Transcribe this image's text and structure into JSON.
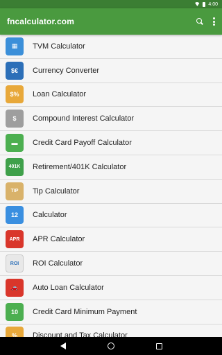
{
  "status_bar": {
    "time": "4:00"
  },
  "app_bar": {
    "title": "fncalculator.com"
  },
  "items": [
    {
      "label": "TVM Calculator",
      "icon": "calculator-icon",
      "color": "#3b8fd9",
      "glyph": "▦"
    },
    {
      "label": "Currency Converter",
      "icon": "currency-icon",
      "color": "#2c6fb8",
      "glyph": "$€"
    },
    {
      "label": "Loan Calculator",
      "icon": "house-icon",
      "color": "#e8a83a",
      "glyph": "$%"
    },
    {
      "label": "Compound Interest Calculator",
      "icon": "bank-icon",
      "color": "#9e9e9e",
      "glyph": "$"
    },
    {
      "label": "Credit Card Payoff Calculator",
      "icon": "credit-card-icon",
      "color": "#4caf50",
      "glyph": "▬"
    },
    {
      "label": "Retirement/401K Calculator",
      "icon": "retirement-icon",
      "color": "#3fa04a",
      "glyph": "401K"
    },
    {
      "label": "Tip Calculator",
      "icon": "tip-icon",
      "color": "#d9b26a",
      "glyph": "TIP"
    },
    {
      "label": "Calculator",
      "icon": "number-grid-icon",
      "color": "#3a8fe0",
      "glyph": "12"
    },
    {
      "label": "APR Calculator",
      "icon": "apr-icon",
      "color": "#d9362b",
      "glyph": "APR"
    },
    {
      "label": "ROI Calculator",
      "icon": "roi-icon",
      "color": "#e8e8e8",
      "glyph": "ROI"
    },
    {
      "label": "Auto Loan Calculator",
      "icon": "car-icon",
      "color": "#d9362b",
      "glyph": "🚗"
    },
    {
      "label": "Credit Card Minimum Payment",
      "icon": "card-payment-icon",
      "color": "#4caf50",
      "glyph": "10"
    },
    {
      "label": "Discount and Tax Calculator",
      "icon": "discount-icon",
      "color": "#e8a83a",
      "glyph": "%"
    }
  ]
}
